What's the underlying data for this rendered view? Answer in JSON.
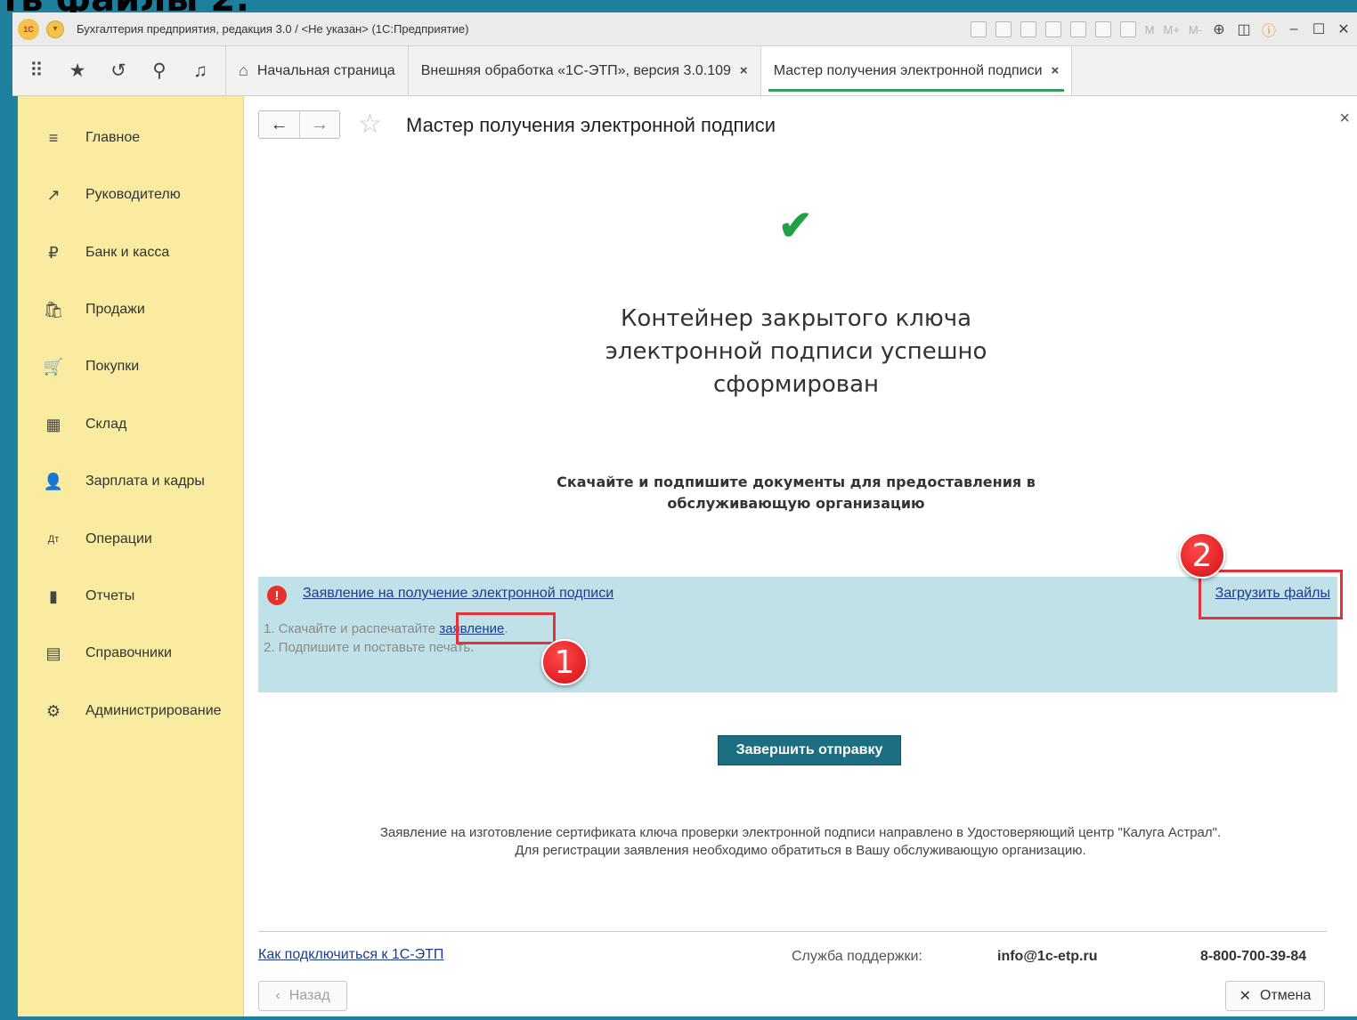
{
  "top_heading": "ть файлы 2:",
  "app": {
    "title": "Бухгалтерия предприятия, редакция 3.0 / <Не указан>  (1С:Предприятие)",
    "logo": "1С",
    "tools": [
      "save-icon",
      "print-icon",
      "preview-icon",
      "upload-icon",
      "scan-icon",
      "calculator-icon",
      "calendar-icon"
    ],
    "memory": [
      "M",
      "M+",
      "M-"
    ]
  },
  "tabs": [
    {
      "label": "Начальная страница",
      "icon": "home-icon"
    },
    {
      "label": "Внешняя обработка «1С-ЭТП», версия 3.0.109",
      "close": "×"
    },
    {
      "label": "Мастер получения электронной подписи",
      "close": "×",
      "active": true
    }
  ],
  "sidebar": {
    "items": [
      {
        "label": "Главное",
        "icon": "≡"
      },
      {
        "label": "Руководителю",
        "icon": "↗"
      },
      {
        "label": "Банк и касса",
        "icon": "₽"
      },
      {
        "label": "Продажи",
        "icon": "🛍"
      },
      {
        "label": "Покупки",
        "icon": "🛒"
      },
      {
        "label": "Склад",
        "icon": "▦"
      },
      {
        "label": "Зарплата и кадры",
        "icon": "👤"
      },
      {
        "label": "Операции",
        "icon": "Дт"
      },
      {
        "label": "Отчеты",
        "icon": "▮"
      },
      {
        "label": "Справочники",
        "icon": "▤"
      },
      {
        "label": "Администрирование",
        "icon": "⚙"
      }
    ]
  },
  "form": {
    "title": "Мастер получения электронной подписи",
    "success_title": "Контейнер закрытого ключа электронной подписи успешно сформирован",
    "subtitle": "Скачайте и подпишите документы для предоставления в обслуживающую организацию",
    "panel": {
      "link": "Заявление на получение электронной подписи",
      "upload": "Загрузить файлы",
      "step1_prefix": "1. Скачайте и распечатайте ",
      "step1_link": "заявление",
      "step1_suffix": ".",
      "step2": "2. Подпишите и поставьте печать."
    },
    "finish_button": "Завершить отправку",
    "notice": "Заявление на изготовление сертификата ключа проверки электронной подписи направлено в Удостоверяющий центр \"Калуга Астрал\". Для регистрации заявления необходимо обратиться в Вашу обслуживающую организацию.",
    "connect_link": "Как подключиться к 1С-ЭТП",
    "support_label": "Служба поддержки:",
    "support_email": "info@1c-etp.ru",
    "support_phone": "8-800-700-39-84",
    "back_button": "Назад",
    "cancel_button": "Отмена"
  },
  "badges": [
    "1",
    "2"
  ],
  "colors": {
    "sidebar": "#f9eb9f",
    "panel": "#c0e1e8",
    "button": "#1b6f80",
    "highlight": "#e3323b",
    "frame": "#1e7f9e"
  }
}
